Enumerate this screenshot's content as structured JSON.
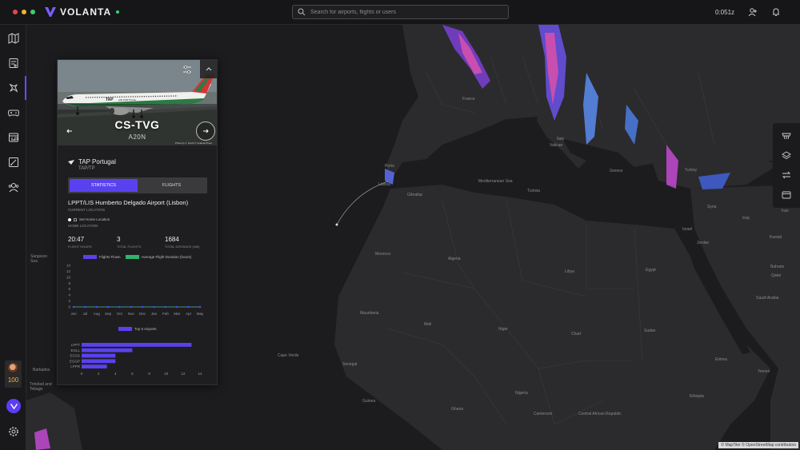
{
  "app": {
    "brand": "VOLANTA",
    "search_placeholder": "Search for airports, flights or users",
    "clock": "0:051z",
    "user_level": "100"
  },
  "colors": {
    "accent": "#5a41f0",
    "avg_duration": "#2fb36d",
    "status_online": "#3bd16f",
    "window_dots": [
      "#e24a4a",
      "#f2b233",
      "#3bd16f"
    ]
  },
  "icons": {
    "topbar": [
      "search-icon",
      "user-friends-icon",
      "bell-icon"
    ],
    "sidebar": [
      "map-icon",
      "flight-plan-icon",
      "airplane-icon",
      "gamepad-icon",
      "logbook-icon",
      "route-icon",
      "community-icon",
      "settings-icon"
    ],
    "tools": [
      "weather-icon",
      "layers-icon",
      "routes-icon",
      "window-icon"
    ]
  },
  "map": {
    "labels": [
      "Sargasso Sea",
      "Cape Verde",
      "Barbados",
      "Trinidad and Tobago",
      "Mediterranean Sea",
      "Lisboa",
      "Gibraltar",
      "Porto",
      "Algeria",
      "Libya",
      "Egypt",
      "Morocco",
      "Mauritania",
      "Mali",
      "Niger",
      "Chad",
      "Sudan",
      "Ethiopia",
      "Nigeria",
      "Turkey",
      "Syria",
      "Iraq",
      "Iran",
      "Greece",
      "Italy",
      "Vatican",
      "France",
      "Tunisia",
      "Senegal",
      "Guinea",
      "Ghana",
      "Cameroon",
      "Central African Republic",
      "Saudi Arabia",
      "Yemen",
      "Israel",
      "Jordan",
      "Kuwait",
      "Bahrain",
      "Qatar",
      "Eritrea"
    ],
    "attribution": "© MapTiler © OpenStreetMap contributors"
  },
  "aircraft": {
    "registration": "CS-TVG",
    "type": "A20N",
    "photo_credit": "Photo by J. Smith © Volanta Photo",
    "airline_name": "TAP Portugal",
    "airline_code": "TAP/TP",
    "tabs": [
      {
        "label": "Statistics",
        "active": true
      },
      {
        "label": "Flights",
        "active": false
      }
    ],
    "current_location": "LPPT/LIS Humberto Delgado Airport (Lisbon)",
    "current_location_label": "Current Location",
    "set_home_label": "Set Home Location",
    "home_location_label": "Home Location",
    "stats": [
      {
        "value": "20:47",
        "label": "Flight Hours"
      },
      {
        "value": "3",
        "label": "Total Flights"
      },
      {
        "value": "1684",
        "label": "Total Distance (NM)"
      }
    ]
  },
  "chart_data": [
    {
      "type": "line",
      "legend": [
        "Flights Flown",
        "Average Flight Duration (hours)"
      ],
      "categories": [
        "Jun",
        "Jul",
        "Aug",
        "Sep",
        "Oct",
        "Nov",
        "Dec",
        "Jan",
        "Feb",
        "Mar",
        "Apr",
        "May"
      ],
      "series": [
        {
          "name": "Flights Flown",
          "values": [
            0,
            0,
            0,
            0,
            0,
            0,
            0,
            0,
            0,
            0,
            0,
            0
          ]
        },
        {
          "name": "Average Flight Duration (hours)",
          "values": [
            0,
            0,
            0,
            0,
            0,
            0,
            0,
            0,
            0,
            0,
            0,
            0
          ]
        }
      ],
      "yticks": [
        0,
        2,
        4,
        6,
        8,
        10,
        12,
        14
      ],
      "ylim": [
        0,
        14
      ],
      "grid": false,
      "legend_position": "top"
    },
    {
      "type": "bar",
      "orientation": "horizontal",
      "legend": [
        "Top 5 Airports"
      ],
      "categories": [
        "LPPT",
        "EGLL",
        "EGSS",
        "EGGP",
        "LPPR"
      ],
      "values": [
        13,
        6,
        4,
        4,
        3
      ],
      "xticks": [
        0,
        2,
        4,
        6,
        8,
        10,
        12,
        14
      ],
      "xlim": [
        0,
        14
      ],
      "grid": false,
      "legend_position": "top"
    }
  ]
}
